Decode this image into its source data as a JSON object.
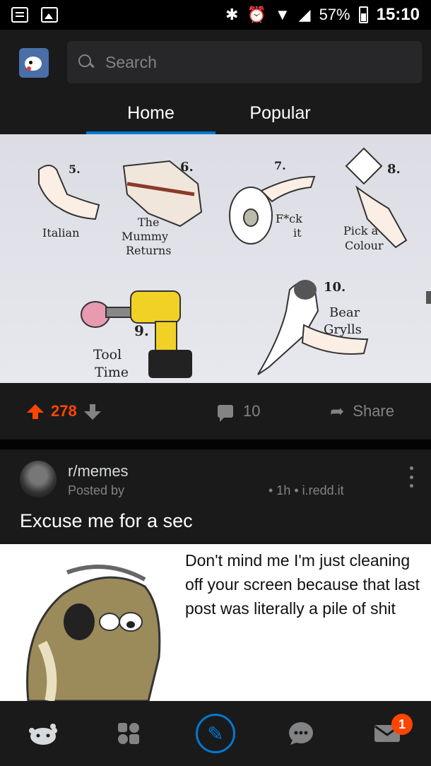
{
  "status_bar": {
    "battery": "57%",
    "time": "15:10"
  },
  "header": {
    "search_placeholder": "Search",
    "tabs": [
      {
        "label": "Home",
        "active": true
      },
      {
        "label": "Popular",
        "active": false
      }
    ]
  },
  "post1": {
    "image_labels": {
      "n5": "5.",
      "italian": "Italian",
      "n6": "6.",
      "mummy": "The\nMummy\nReturns",
      "n7": "7.",
      "fck": "F*ck\nit",
      "n8": "8.",
      "pick": "Pick a\nColour",
      "n9": "9.",
      "tool": "Tool\nTime",
      "n10": "10.",
      "bear": "Bear\nGrylls"
    },
    "score": "278",
    "comments": "10",
    "share_label": "Share"
  },
  "post2": {
    "subreddit": "r/memes",
    "posted_by": "Posted by",
    "meta": "• 1h • i.redd.it",
    "title": "Excuse me for a sec",
    "meme_text": "Don't mind me I'm just cleaning off your screen because that last post was literally a pile of shit"
  },
  "bottom_nav": {
    "inbox_badge": "1"
  },
  "colors": {
    "accent": "#0079d3",
    "upvote": "#ff4500",
    "background": "#1a1a1b",
    "muted": "#818384"
  }
}
